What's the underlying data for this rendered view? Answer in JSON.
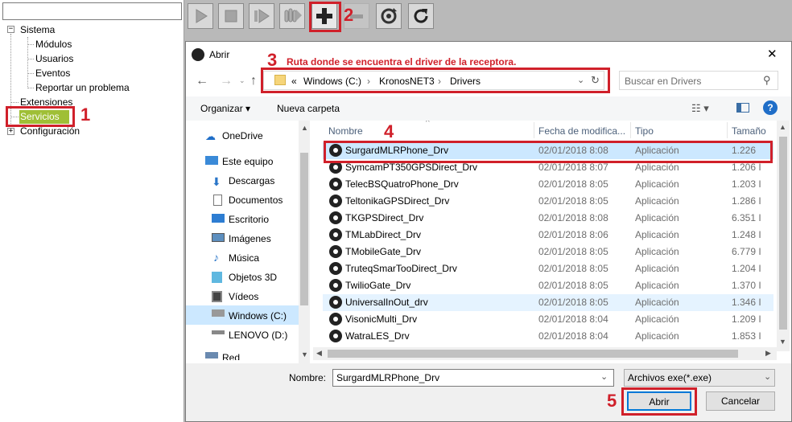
{
  "tree": {
    "items": [
      {
        "label": "Sistema",
        "expander": "−"
      },
      {
        "label": "Módulos"
      },
      {
        "label": "Usuarios"
      },
      {
        "label": "Eventos"
      },
      {
        "label": "Reportar un problema"
      },
      {
        "label": "Extensiones"
      },
      {
        "label": "Servicios"
      },
      {
        "label": "Configuración",
        "expander": "+"
      }
    ]
  },
  "annotations": {
    "n1": "1",
    "n2": "2",
    "n3": "3",
    "n4": "4",
    "n5": "5",
    "route_note": "Ruta donde se encuentra el driver de la receptora.",
    "color": "#d0202a"
  },
  "toolbar": {
    "buttons": [
      "play-icon",
      "stop-icon",
      "step-icon",
      "hand-icon",
      "plus-icon",
      "minus-icon",
      "gear-refresh-icon",
      "refresh-icon"
    ]
  },
  "dialog": {
    "title": "Abrir",
    "close_glyph": "✕",
    "address": {
      "prefix": "«",
      "parts": [
        "Windows (C:)",
        "KronosNET3",
        "Drivers"
      ],
      "sep": "›"
    },
    "search_placeholder": "Buscar en Drivers",
    "cmd": {
      "organize": "Organizar ▾",
      "new_folder": "Nueva carpeta"
    },
    "nav": [
      {
        "label": "OneDrive",
        "icon": "cloud-icon"
      },
      {
        "label": "Este equipo",
        "icon": "computer-icon"
      },
      {
        "label": "Descargas",
        "icon": "download-icon"
      },
      {
        "label": "Documentos",
        "icon": "document-icon"
      },
      {
        "label": "Escritorio",
        "icon": "desktop-icon"
      },
      {
        "label": "Imágenes",
        "icon": "images-icon"
      },
      {
        "label": "Música",
        "icon": "music-icon"
      },
      {
        "label": "Objetos 3D",
        "icon": "cube-icon"
      },
      {
        "label": "Vídeos",
        "icon": "video-icon"
      },
      {
        "label": "Windows (C:)",
        "icon": "drive-icon"
      },
      {
        "label": "LENOVO (D:)",
        "icon": "drive-icon"
      },
      {
        "label": "Red",
        "icon": "network-icon"
      }
    ],
    "columns": {
      "name": "Nombre",
      "date": "Fecha de modifica...",
      "type": "Tipo",
      "size": "Tamaño"
    },
    "files": [
      {
        "name": "SurgardMLRPhone_Drv",
        "date": "02/01/2018 8:08",
        "type": "Aplicación",
        "size": "1.226"
      },
      {
        "name": "SymcamPT350GPSDirect_Drv",
        "date": "02/01/2018 8:07",
        "type": "Aplicación",
        "size": "1.206 I"
      },
      {
        "name": "TelecBSQuatroPhone_Drv",
        "date": "02/01/2018 8:05",
        "type": "Aplicación",
        "size": "1.203 I"
      },
      {
        "name": "TeltonikaGPSDirect_Drv",
        "date": "02/01/2018 8:05",
        "type": "Aplicación",
        "size": "1.286 I"
      },
      {
        "name": "TKGPSDirect_Drv",
        "date": "02/01/2018 8:08",
        "type": "Aplicación",
        "size": "6.351 I"
      },
      {
        "name": "TMLabDirect_Drv",
        "date": "02/01/2018 8:06",
        "type": "Aplicación",
        "size": "1.248 I"
      },
      {
        "name": "TMobileGate_Drv",
        "date": "02/01/2018 8:05",
        "type": "Aplicación",
        "size": "6.779 I"
      },
      {
        "name": "TruteqSmarTooDirect_Drv",
        "date": "02/01/2018 8:05",
        "type": "Aplicación",
        "size": "1.204 I"
      },
      {
        "name": "TwilioGate_Drv",
        "date": "02/01/2018 8:05",
        "type": "Aplicación",
        "size": "1.370 I"
      },
      {
        "name": "UniversalInOut_drv",
        "date": "02/01/2018 8:05",
        "type": "Aplicación",
        "size": "1.346 I"
      },
      {
        "name": "VisonicMulti_Drv",
        "date": "02/01/2018 8:04",
        "type": "Aplicación",
        "size": "1.209 I"
      },
      {
        "name": "WatraLES_Drv",
        "date": "02/01/2018 8:04",
        "type": "Aplicación",
        "size": "1.853 I"
      }
    ],
    "filename_label": "Nombre:",
    "filename_value": "SurgardMLRPhone_Drv",
    "filetype_value": "Archivos exe(*.exe)",
    "open_label": "Abrir",
    "cancel_label": "Cancelar"
  }
}
